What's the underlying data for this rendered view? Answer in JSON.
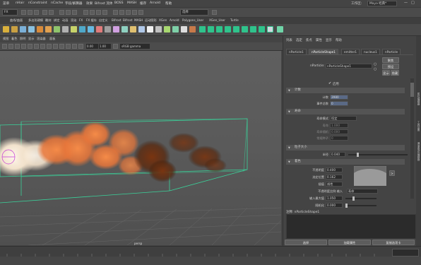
{
  "menubar": {
    "items": [
      "菜单",
      "nHair",
      "nConstraint",
      "nCache",
      "字段/解算器",
      "效果",
      "Bifrost 流体",
      "BOSS",
      "MASH",
      "缓存",
      "Arnold",
      "帮助"
    ],
    "workspace_label": "工作区:",
    "workspace_value": "Maya 经典*"
  },
  "statusline": {
    "menu_set": "FX",
    "mode_select": "选择"
  },
  "shelf": {
    "tabs": [
      "曲线/曲面",
      "多边形建模",
      "雕刻",
      "绑定",
      "动画",
      "渲染",
      "FX",
      "FX 缓存",
      "自定义",
      "Bifrost",
      "Bifrost",
      "MASH",
      "运动图形",
      "XGen",
      "Arnold",
      "Polygons_User",
      "XGen_User",
      "Turtle"
    ]
  },
  "viewport": {
    "menu": [
      "视图",
      "着色",
      "照明",
      "显示",
      "渲染器",
      "面板"
    ],
    "toolbar": {
      "near_value": "0.00",
      "far_value": "1.00",
      "color_space": "sRGB gamma"
    },
    "camera_label": "persp"
  },
  "attribute_editor": {
    "menu": [
      "列表",
      "选定",
      "焦点",
      "属性",
      "显示",
      "帮助"
    ],
    "tabs": [
      "nParticle1",
      "nParticleShape1",
      "emitter1",
      "nucleus1",
      "nParticle"
    ],
    "active_tab": "nParticleShape1",
    "node_label": "nParticle:",
    "node_value": "nParticleShape1",
    "focus_button": "聚焦",
    "presets_button": "预设",
    "show_button": "显示",
    "hide_button": "隐藏",
    "enable_label": "启用",
    "sections": {
      "count": "计数",
      "lifespan": "寿命",
      "particle_size": "粒子大小",
      "shading": "着色"
    },
    "count_fields": [
      {
        "label": "计数",
        "value": "3980"
      },
      {
        "label": "事件总数",
        "value": "0"
      }
    ],
    "lifespan_fields": [
      {
        "label": "寿命模式",
        "value": "恒定"
      },
      {
        "label": "寿命",
        "value": "1.000"
      },
      {
        "label": "寿命随机",
        "value": "0.000"
      },
      {
        "label": "常规种子",
        "value": "0"
      }
    ],
    "particle_size": {
      "radius_label": "半径",
      "radius_value": "0.040"
    },
    "shading": {
      "opacity_label": "不透明度",
      "opacity_value": "0.400",
      "ramp_label": "选定位置",
      "ramp_value": "0.162",
      "interp_label": "插值",
      "interp_value": "线性",
      "input_label": "不透明度比例 输入",
      "input_value": "寿命",
      "input_max_label": "输入最大值",
      "input_max_value": "1.050",
      "randomize_label": "随机化",
      "randomize_value": "0.000"
    },
    "notes_label": "注释: nParticleShape1",
    "buttons": [
      "选择",
      "加载属性",
      "复制选项卡"
    ]
  },
  "rightstrip": {
    "tabs": [
      "属性编辑器",
      "工具设置",
      "通道盒/层编辑器"
    ]
  },
  "colors": {
    "fire_core": "#f2e2cc",
    "fire_orange": "#e8763a",
    "smoke_dark": "#5a2a10",
    "bbox": "#3ad29a"
  }
}
